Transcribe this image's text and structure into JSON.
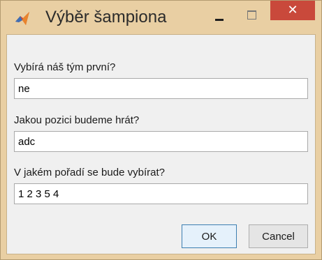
{
  "window": {
    "title": "Výběr šampiona",
    "close_glyph": "✕"
  },
  "form": {
    "fields": [
      {
        "label": "Vybírá náš tým první?",
        "value": "ne"
      },
      {
        "label": "Jakou pozici budeme hrát?",
        "value": "adc"
      },
      {
        "label": "V jakém pořadí se bude vybírat?",
        "value": "1 2 3 5 4"
      }
    ]
  },
  "buttons": {
    "ok_label": "OK",
    "cancel_label": "Cancel"
  },
  "colors": {
    "titlebar": "#e9cfa3",
    "close_button": "#c9493b",
    "client": "#f0f0f0",
    "ok_border": "#3c7fb1"
  },
  "icons": {
    "app": "matlab-icon",
    "minimize": "minimize-icon",
    "maximize": "maximize-icon",
    "close": "close-icon"
  }
}
